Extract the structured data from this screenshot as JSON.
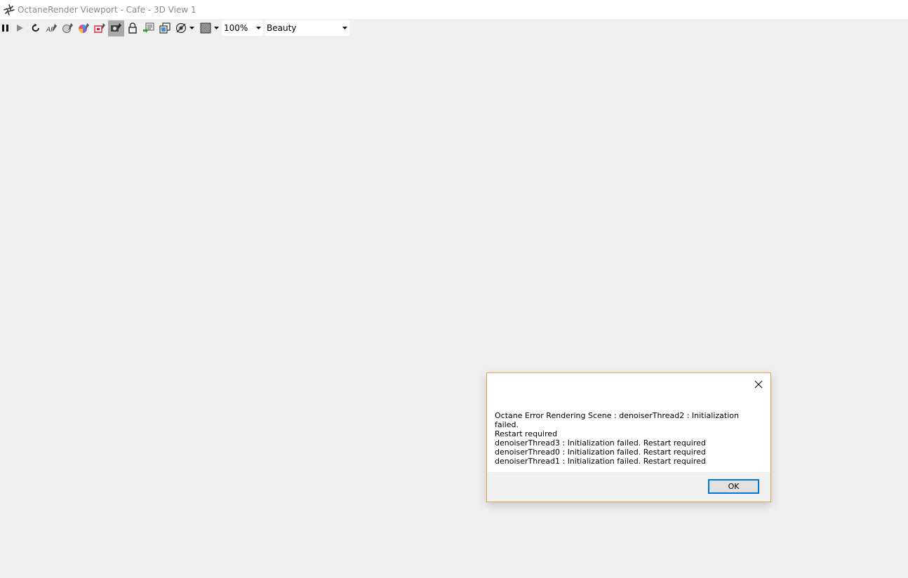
{
  "window": {
    "title": "OctaneRender Viewport - Cafe - 3D View 1",
    "logo_icon": "octane-logo-icon"
  },
  "toolbar": {
    "buttons": [
      {
        "name": "pause-button",
        "icon": "pause-icon"
      },
      {
        "name": "play-button",
        "icon": "play-icon"
      },
      {
        "name": "restart-button",
        "icon": "refresh-icon"
      },
      {
        "name": "af-focus-button",
        "icon": "af-picker-icon"
      },
      {
        "name": "material-picker-button",
        "icon": "material-picker-icon"
      },
      {
        "name": "color-picker-button",
        "icon": "color-wheel-icon"
      },
      {
        "name": "region-render-button",
        "icon": "region-icon"
      },
      {
        "name": "camera-lock-button",
        "icon": "camera-icon",
        "active": true
      },
      {
        "name": "lock-button",
        "icon": "lock-icon"
      },
      {
        "name": "export-button",
        "icon": "export-icon"
      },
      {
        "name": "copy-button",
        "icon": "copy-icon"
      },
      {
        "name": "hide-button",
        "icon": "eye-off-icon"
      },
      {
        "name": "background-button",
        "icon": "checker-icon"
      }
    ],
    "zoom_value": "100%",
    "view_value": "Beauty"
  },
  "dialog": {
    "close_icon": "close-icon",
    "message": "Octane Error Rendering Scene : denoiserThread2 : Initialization failed.\nRestart required\ndenoiserThread3 : Initialization failed. Restart required\ndenoiserThread0 : Initialization failed. Restart required\ndenoiserThread1 : Initialization failed. Restart required",
    "ok_label": "OK"
  },
  "colors": {
    "dialog_border": "#e0a34b",
    "ok_focus": "#0078d7",
    "background": "#f0f0f0"
  }
}
